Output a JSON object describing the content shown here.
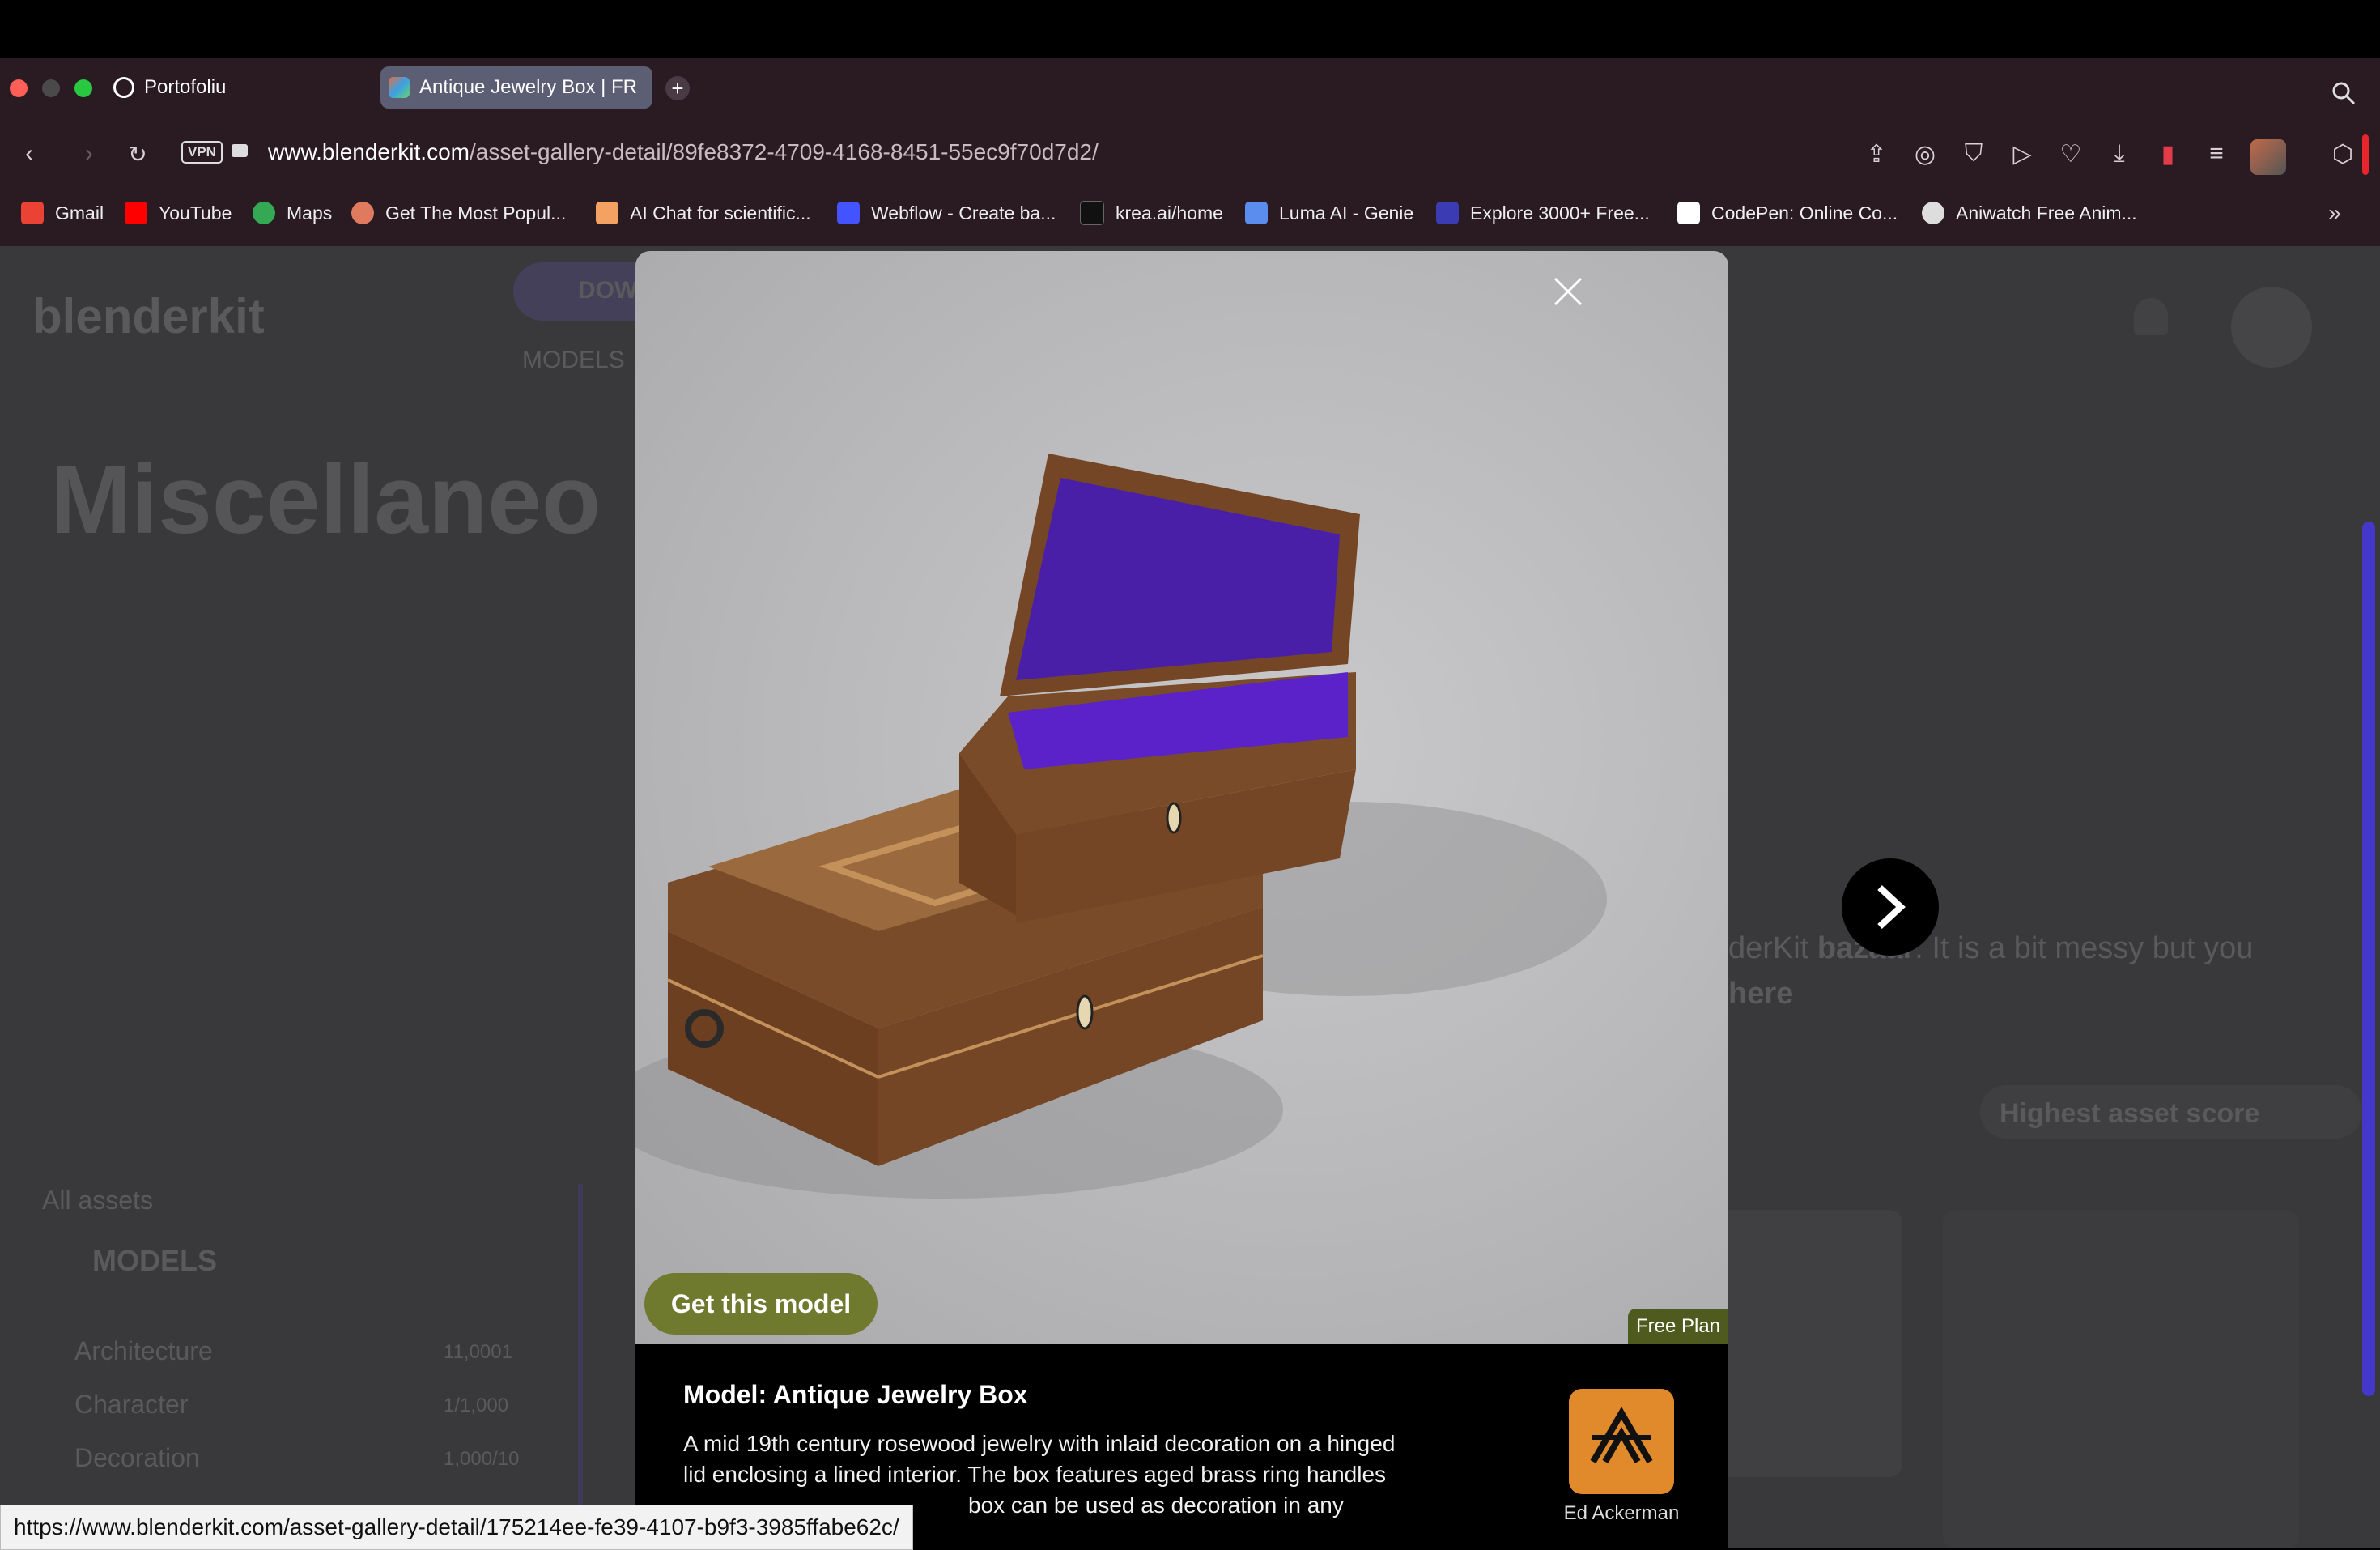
{
  "browser": {
    "tabs": [
      {
        "label": "Portofoliu"
      },
      {
        "label": "Antique Jewelry Box | FR"
      }
    ],
    "new_tab_icon": "plus-icon",
    "vpn_badge": "VPN",
    "url_domain": "www.blenderkit.com",
    "url_path": "/asset-gallery-detail/89fe8372-4709-4168-8451-55ec9f70d7d2/",
    "bookmarks": [
      {
        "label": "Gmail",
        "color": "#ea4335"
      },
      {
        "label": "YouTube",
        "color": "#ff0000"
      },
      {
        "label": "Maps",
        "color": "#34a853"
      },
      {
        "label": "Get The Most Popul...",
        "color": "#e07a5f"
      },
      {
        "label": "AI Chat for scientific...",
        "color": "#f4a261"
      },
      {
        "label": "Webflow - Create ba...",
        "color": "#4353ff"
      },
      {
        "label": "krea.ai/home",
        "color": "#222222"
      },
      {
        "label": "Luma AI - Genie",
        "color": "#5b8def"
      },
      {
        "label": "Explore 3000+ Free...",
        "color": "#3b3bb3"
      },
      {
        "label": "CodePen: Online Co...",
        "color": "#ffffff"
      },
      {
        "label": "Aniwatch Free Anim...",
        "color": "#dddddd"
      }
    ],
    "status_url": "https://www.blenderkit.com/asset-gallery-detail/175214ee-fe39-4107-b9f3-3985ffabe62c/"
  },
  "background_page": {
    "logo": "blenderkit",
    "download_label": "DOW",
    "nav_models": "MODELS",
    "heading": "Miscellaneo",
    "bazaar_text_1": "derKit",
    "bazaar_bold": "bazaar",
    "bazaar_text_2": ". It is a bit messy but you",
    "bazaar_line2": "here",
    "sort_label": "Highest asset score",
    "all_assets": "All assets",
    "models_heading": "MODELS",
    "categories": [
      {
        "label": "Architecture",
        "count": "11,0001"
      },
      {
        "label": "Character",
        "count": "1/1,000"
      },
      {
        "label": "Decoration",
        "count": "1,000/10"
      }
    ]
  },
  "modal": {
    "cta_label": "Get this model",
    "plan_badge": "Free Plan",
    "title": "Model: Antique Jewelry Box",
    "description_lines": [
      "A mid 19th century rosewood jewelry with inlaid decoration on a hinged",
      "lid enclosing a lined interior. The box features aged brass ring handles",
      "box can be used as decoration in any"
    ],
    "author_name": "Ed Ackerman",
    "colors": {
      "cta_bg": "#6f7a2e",
      "plan_bg": "#4e5a1e",
      "box_wood": "#8a5a32",
      "lining": "#4a1fa8",
      "author_bg": "#e08a2c"
    }
  }
}
